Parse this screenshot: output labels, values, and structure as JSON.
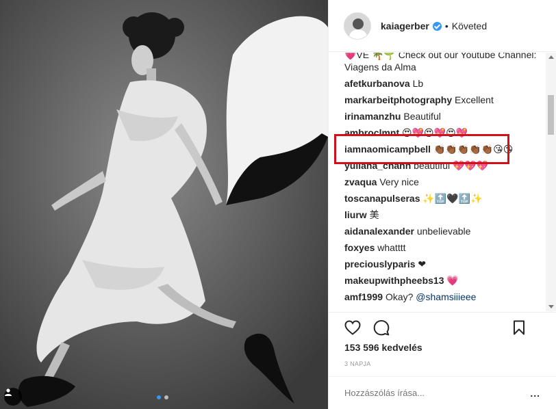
{
  "post": {
    "username": "kaiagerber",
    "follow_status": "Követed",
    "separator": "•",
    "likes": "153 596 kedvelés",
    "time": "3 NAPJA",
    "comment_placeholder": "Hozzászólás írása...",
    "more": "..."
  },
  "comments": [
    {
      "user": "",
      "text": "💗VE 🌴🌱 Check out our Youtube Channel:",
      "partial": true
    },
    {
      "user": "",
      "text": "Viagens da Alma"
    },
    {
      "user": "afetkurbanova",
      "text": "Lb"
    },
    {
      "user": "markarbeitphotography",
      "text": "Excellent"
    },
    {
      "user": "irinamanzhu",
      "text": "Beautiful"
    },
    {
      "user": "ambroclmnt",
      "text": "😍💖😍💖😍💖"
    },
    {
      "user": "iamnaomicampbell",
      "text": "👏🏾👏🏾👏🏾👏🏾👏🏾😘😘"
    },
    {
      "user": "yuliana_chann",
      "text": "beautiful 💖💖💖"
    },
    {
      "user": "zvaqua",
      "text": "Very nice"
    },
    {
      "user": "toscanapulseras",
      "text": "✨🔝🖤🔝✨"
    },
    {
      "user": "liurw",
      "text": "美"
    },
    {
      "user": "aidanalexander",
      "text": "unbelievable"
    },
    {
      "user": "foxyes",
      "text": "whatttt"
    },
    {
      "user": "preciouslyparis",
      "text": "❤"
    },
    {
      "user": "makeupwithpheebs13",
      "text": "💗"
    },
    {
      "user": "amf1999",
      "text": "Okay? @shamsiiieee"
    }
  ],
  "colors": {
    "highlight": "#d0111b",
    "verified": "#3897f0",
    "text": "#262626",
    "mention": "#003569"
  },
  "icons": [
    "heart-icon",
    "comment-icon",
    "bookmark-icon",
    "user-tag-icon",
    "verified-icon"
  ]
}
